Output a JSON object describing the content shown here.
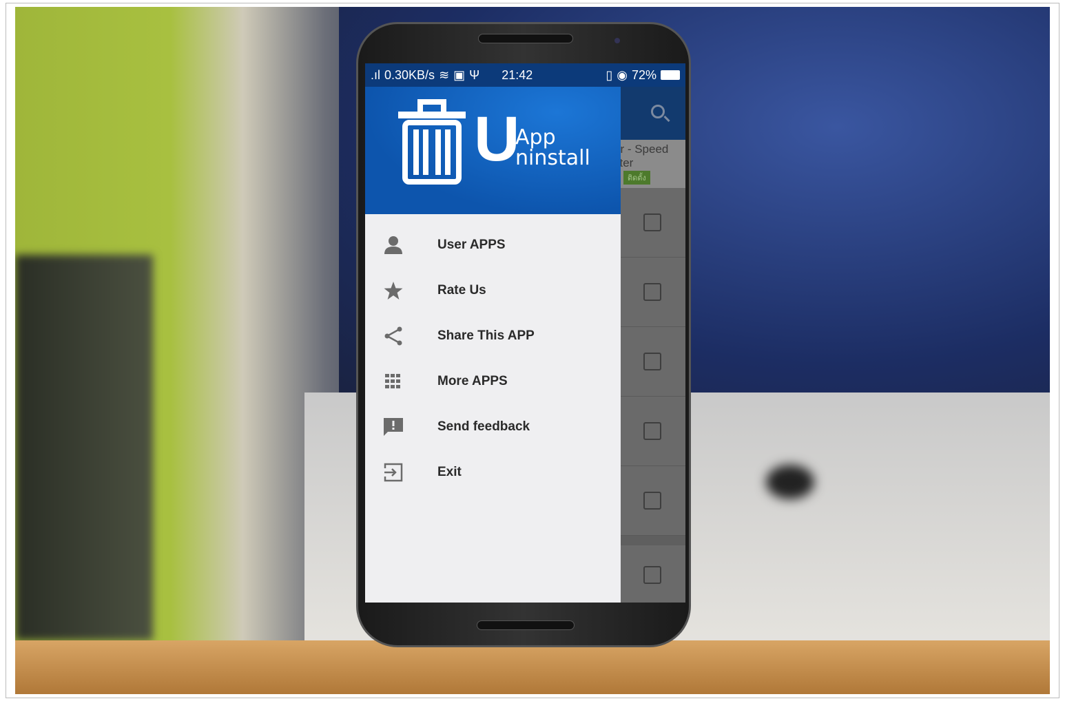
{
  "status_bar": {
    "network_speed": "0.30KB/s",
    "time": "21:42",
    "battery": "72%"
  },
  "drawer": {
    "logo": {
      "big_letter": "U",
      "line1": "App",
      "line2": "ninstall"
    },
    "items": [
      {
        "label": "User APPS",
        "icon": "person-icon"
      },
      {
        "label": "Rate Us",
        "icon": "star-icon"
      },
      {
        "label": "Share This APP",
        "icon": "share-icon"
      },
      {
        "label": "More APPS",
        "icon": "apps-grid-icon"
      },
      {
        "label": "Send feedback",
        "icon": "feedback-icon"
      },
      {
        "label": "Exit",
        "icon": "exit-icon"
      }
    ]
  },
  "background_list": {
    "partial_title_line1": "er - Speed",
    "partial_title_line2": "ster",
    "install_badge": "ติดตั้ง"
  },
  "colors": {
    "header_blue": "#0d55ad",
    "status_bar": "#0c3a7a",
    "drawer_bg": "#efeff1",
    "icon_gray": "#6b6b6b"
  }
}
